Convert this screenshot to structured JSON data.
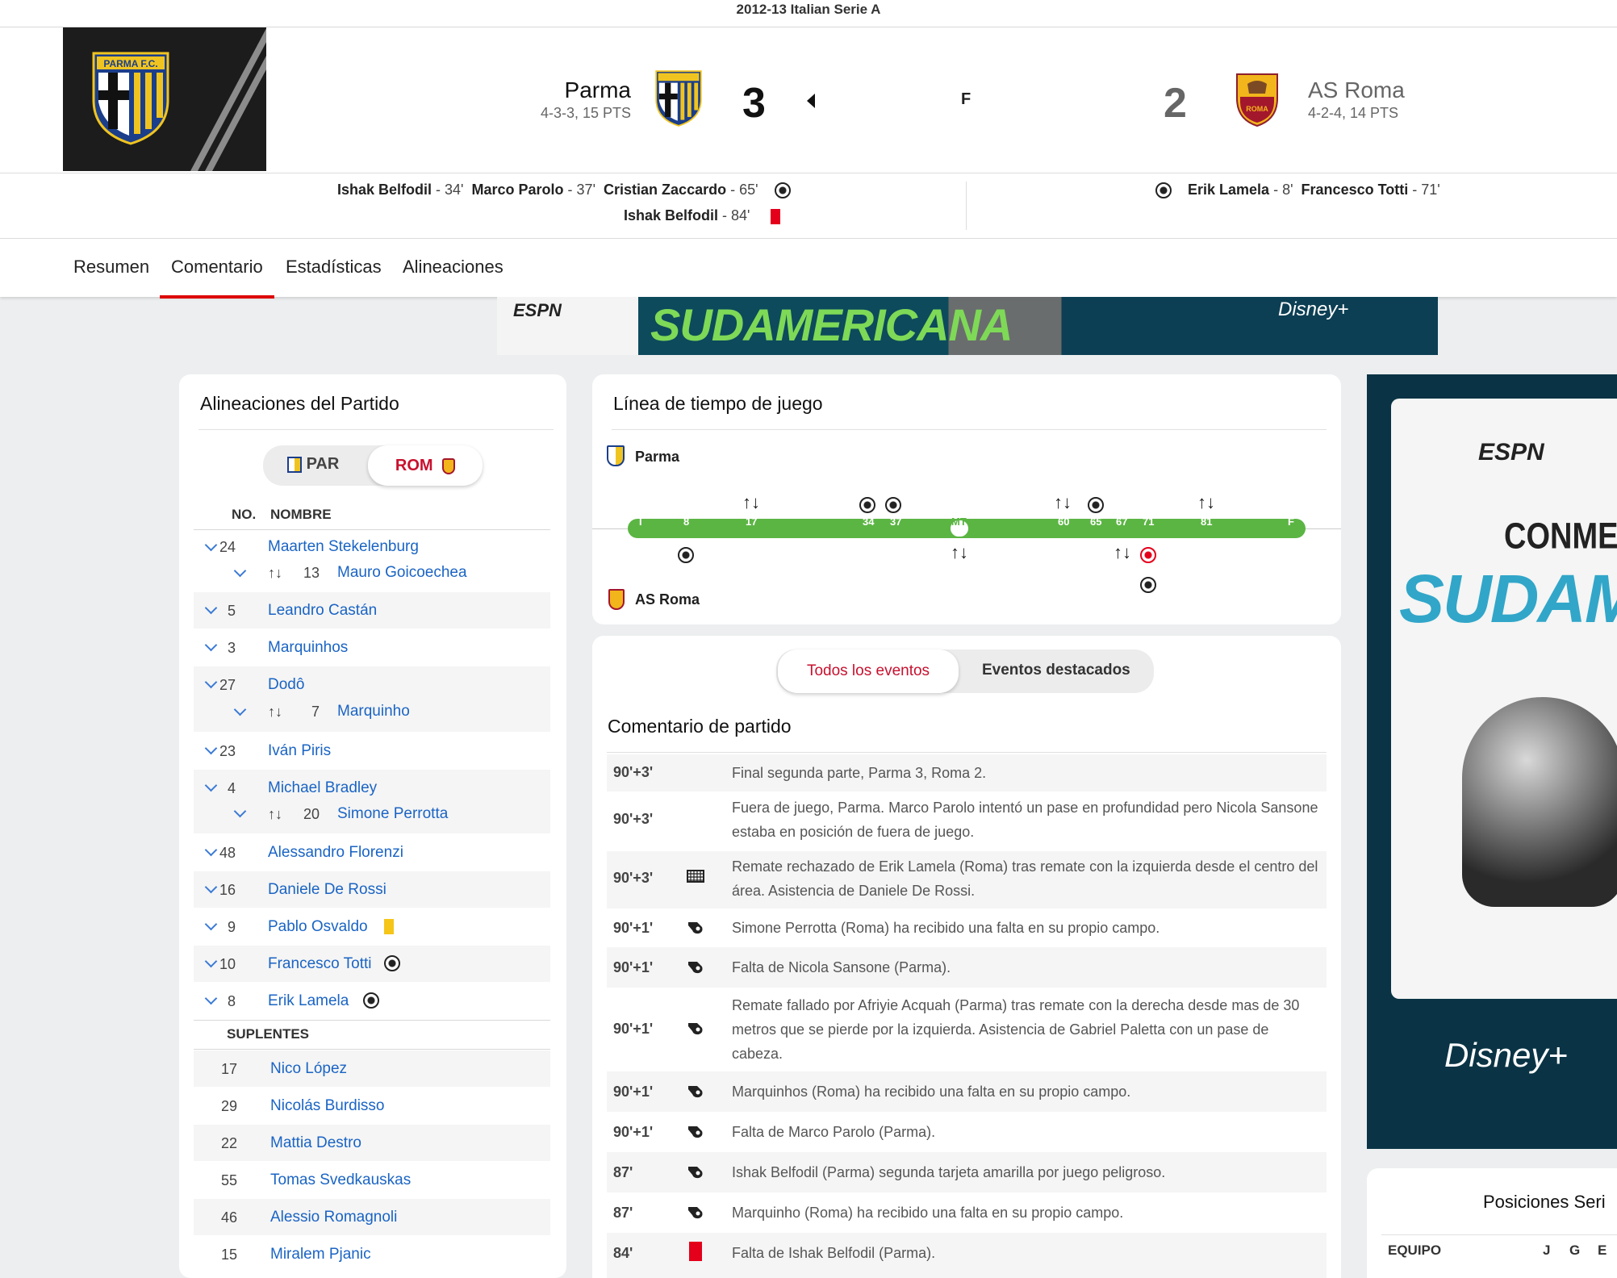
{
  "competition": "2012-13 Italian Serie A",
  "home": {
    "name": "Parma",
    "record": "4-3-3, 15 PTS",
    "score": "3",
    "abbr": "PAR",
    "crest_text": "PARMA F.C."
  },
  "away": {
    "name": "AS Roma",
    "record": "4-2-4, 14 PTS",
    "score": "2",
    "abbr": "ROM",
    "crest_text": "ROMA"
  },
  "status": "F",
  "home_scorers": {
    "line1": [
      {
        "name": "Ishak Belfodil",
        "min": "34'"
      },
      {
        "name": "Marco Parolo",
        "min": "37'"
      },
      {
        "name": "Cristian Zaccardo",
        "min": "65'"
      }
    ],
    "line2": [
      {
        "name": "Ishak Belfodil",
        "min": "84'"
      }
    ]
  },
  "away_scorers": {
    "line1": [
      {
        "name": "Erik Lamela",
        "min": "8'"
      },
      {
        "name": "Francesco Totti",
        "min": "71'"
      }
    ]
  },
  "tabs": [
    "Resumen",
    "Comentario",
    "Estadísticas",
    "Alineaciones"
  ],
  "banner": {
    "brand": "ESPN",
    "title": "SUDAMERICANA",
    "partner": "Disney+"
  },
  "lineups": {
    "title": "Alineaciones del Partido",
    "toggle": {
      "home": "PAR",
      "away": "ROM"
    },
    "col_no": "NO.",
    "col_name": "NOMBRE",
    "starters": [
      {
        "no": "24",
        "name": "Maarten Stekelenburg",
        "sub": {
          "no": "13",
          "name": "Mauro Goicoechea"
        }
      },
      {
        "no": "5",
        "name": "Leandro Castán"
      },
      {
        "no": "3",
        "name": "Marquinhos"
      },
      {
        "no": "27",
        "name": "Dodô",
        "sub": {
          "no": "7",
          "name": "Marquinho"
        }
      },
      {
        "no": "23",
        "name": "Iván Piris"
      },
      {
        "no": "4",
        "name": "Michael Bradley",
        "sub": {
          "no": "20",
          "name": "Simone Perrotta"
        }
      },
      {
        "no": "48",
        "name": "Alessandro Florenzi"
      },
      {
        "no": "16",
        "name": "Daniele De Rossi"
      },
      {
        "no": "9",
        "name": "Pablo Osvaldo"
      },
      {
        "no": "10",
        "name": "Francesco Totti"
      },
      {
        "no": "8",
        "name": "Erik Lamela"
      }
    ],
    "subs_title": "SUPLENTES",
    "subs": [
      {
        "no": "17",
        "name": "Nico López"
      },
      {
        "no": "29",
        "name": "Nicolás Burdisso"
      },
      {
        "no": "22",
        "name": "Mattia Destro"
      },
      {
        "no": "55",
        "name": "Tomas Svedkauskas"
      },
      {
        "no": "46",
        "name": "Alessio Romagnoli"
      },
      {
        "no": "15",
        "name": "Miralem Pjanic"
      }
    ]
  },
  "timeline": {
    "title": "Línea de tiempo de juego",
    "home": "Parma",
    "away": "AS Roma",
    "ticks": [
      "I",
      "8",
      "17",
      "34",
      "37",
      "MT",
      "60",
      "65",
      "67",
      "71",
      "81",
      "F"
    ]
  },
  "commentary": {
    "toggle": {
      "all": "Todos los eventos",
      "key": "Eventos destacados"
    },
    "title": "Comentario de partido",
    "rows": [
      {
        "time": "90'+3'",
        "icon": "",
        "text": "Final segunda parte, Parma 3, Roma 2."
      },
      {
        "time": "90'+3'",
        "icon": "",
        "text": "Fuera de juego, Parma. Marco Parolo intentó un pase en profundidad pero Nicola Sansone estaba en posición de fuera de juego."
      },
      {
        "time": "90'+3'",
        "icon": "goal-net",
        "text": "Remate rechazado de Erik Lamela (Roma) tras remate con la izquierda desde el centro del área. Asistencia de Daniele De Rossi."
      },
      {
        "time": "90'+1'",
        "icon": "whistle",
        "text": "Simone Perrotta (Roma) ha recibido una falta en su propio campo."
      },
      {
        "time": "90'+1'",
        "icon": "whistle",
        "text": "Falta de Nicola Sansone (Parma)."
      },
      {
        "time": "90'+1'",
        "icon": "whistle",
        "text": "Remate fallado por Afriyie Acquah (Parma) tras remate con la derecha desde mas de 30 metros que se pierde por la izquierda. Asistencia de Gabriel Paletta con un pase de cabeza."
      },
      {
        "time": "90'+1'",
        "icon": "whistle",
        "text": "Marquinhos (Roma) ha recibido una falta en su propio campo."
      },
      {
        "time": "90'+1'",
        "icon": "whistle",
        "text": "Falta de Marco Parolo (Parma)."
      },
      {
        "time": "87'",
        "icon": "whistle",
        "text": "Ishak Belfodil (Parma) segunda tarjeta amarilla por juego peligroso."
      },
      {
        "time": "87'",
        "icon": "whistle",
        "text": "Marquinho (Roma) ha recibido una falta en su propio campo."
      },
      {
        "time": "84'",
        "icon": "red-card",
        "text": "Falta de Ishak Belfodil (Parma)."
      }
    ]
  },
  "side_ad": {
    "brand": "ESPN",
    "line1": "CONMEBOL",
    "line2": "SUDAMERI",
    "partner": "Disney+"
  },
  "standings": {
    "title": "Posiciones Seri",
    "col_team": "EQUIPO",
    "cols": [
      "J",
      "G",
      "E"
    ]
  },
  "colors": {
    "accent": "#d00000",
    "link": "#1a64c4",
    "timeline_bar": "#5bb543",
    "red_card": "#e4001b",
    "yellow_card": "#f5c518"
  }
}
